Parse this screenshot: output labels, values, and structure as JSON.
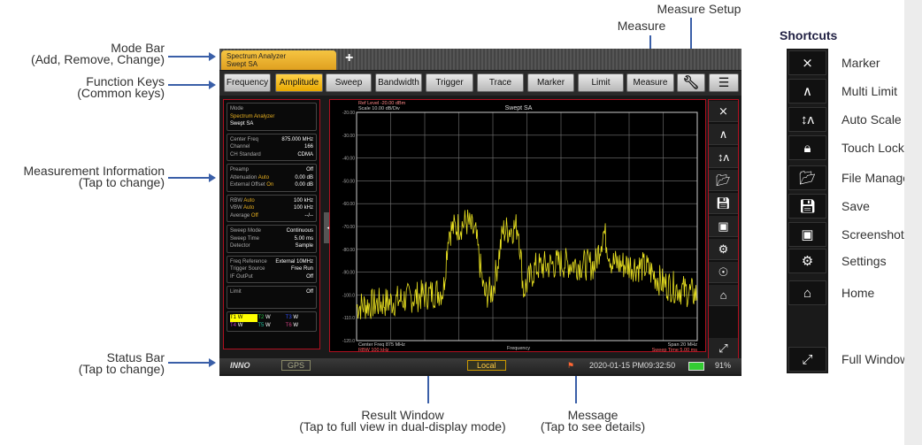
{
  "annotations": {
    "mode_bar": [
      "Mode Bar",
      "(Add, Remove, Change)"
    ],
    "function_keys": [
      "Function Keys",
      "(Common keys)"
    ],
    "measurement_info": [
      "Measurement Information",
      "(Tap to change)"
    ],
    "status_bar": [
      "Status Bar",
      "(Tap to change)"
    ],
    "measure": "Measure",
    "measure_setup": "Measure Setup",
    "result_window": [
      "Result Window",
      "(Tap to full view in dual-display mode)"
    ],
    "message": [
      "Message",
      "(Tap to see details)"
    ]
  },
  "mode_tab": {
    "line1": "Spectrum Analyzer",
    "line2": "Swept SA",
    "add": "+"
  },
  "function_keys": [
    "Frequency",
    "Amplitude",
    "Sweep",
    "Bandwidth",
    "Trigger",
    "Trace",
    "Marker",
    "Limit",
    "Measure"
  ],
  "selected_key": "Amplitude",
  "info": {
    "mode": {
      "label": "Mode",
      "app": "Spectrum Analyzer",
      "sub": "Swept SA"
    },
    "freq": [
      [
        "Center Freq",
        "875.000 MHz"
      ],
      [
        "Channel",
        "166"
      ],
      [
        "CH Standard",
        "CDMA"
      ]
    ],
    "amp": [
      [
        "Preamp",
        "",
        "Off"
      ],
      [
        "Attenuation",
        "Auto",
        "0.00 dB"
      ],
      [
        "External Offset",
        "On",
        "0.00 dB"
      ]
    ],
    "bw": [
      [
        "RBW",
        "Auto",
        "100 kHz"
      ],
      [
        "VBW",
        "Auto",
        "100 kHz"
      ],
      [
        "Average",
        "Off",
        "--/--"
      ]
    ],
    "sweep": [
      [
        "Sweep Mode",
        "Continuous"
      ],
      [
        "Sweep Time",
        "5.00 ms"
      ],
      [
        "Detector",
        "Sample"
      ]
    ],
    "trig": [
      [
        "Freq Reference",
        "External 10MHz"
      ],
      [
        "Trigger Source",
        "Free Run"
      ],
      [
        "IF OutPut",
        "Off"
      ]
    ],
    "limit": [
      "Limit",
      "Off"
    ],
    "traces": [
      [
        "T1",
        "W",
        "#ffff00"
      ],
      [
        "T2",
        "W",
        "#20c040"
      ],
      [
        "T3",
        "W",
        "#3050ff"
      ],
      [
        "T4",
        "W",
        "#c040c0"
      ],
      [
        "T5",
        "W",
        "#20c0a0"
      ],
      [
        "T6",
        "W",
        "#d04080"
      ]
    ]
  },
  "chart_data": {
    "type": "line",
    "title": "Swept SA",
    "ref_level": "Ref Level -20.00 dBm",
    "scale": "Scale 10.00 dB/Div",
    "ylim": [
      -120,
      -20
    ],
    "yticks": [
      "-20.00",
      "-30.00",
      "-40.00",
      "-50.00",
      "-60.00",
      "-70.00",
      "-80.00",
      "-90.00",
      "-100.0",
      "-110.0",
      "-120.0"
    ],
    "xlim": [
      865,
      885
    ],
    "xlabel": "Frequency",
    "center": "Center Freq 875 MHz",
    "rbw": "RBW 100 kHz",
    "span": "Span 20 MHz",
    "sweep_time": "Sweep Time 5.00 ms",
    "series": [
      {
        "name": "T1",
        "color": "#e8e020",
        "x": [
          865,
          867,
          869,
          870.1,
          870.4,
          871.5,
          872,
          872.5,
          873,
          873.6,
          874.5,
          874.8,
          875.5,
          877,
          879,
          879.5,
          880,
          882,
          883,
          885
        ],
        "y": [
          -105,
          -103,
          -100,
          -98,
          -72,
          -68,
          -74,
          -100,
          -98,
          -72,
          -70,
          -98,
          -88,
          -86,
          -87,
          -72,
          -86,
          -88,
          -95,
          -100
        ]
      }
    ]
  },
  "status": {
    "gps": "GPS",
    "local": "Local",
    "datetime": "2020-01-15  PM09:32:50",
    "battery": "91%"
  },
  "shortcuts": {
    "title": "Shortcuts",
    "items": [
      "Marker",
      "Multi Limit",
      "Auto Scale",
      "Touch Lock",
      "File Manager",
      "Save",
      "Screenshot",
      "Settings",
      "Home",
      "Full Window"
    ]
  }
}
